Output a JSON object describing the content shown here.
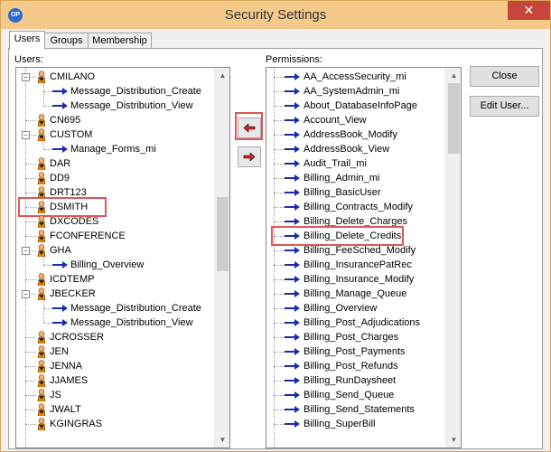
{
  "window": {
    "title": "Security Settings",
    "app_icon": "OP",
    "close_symbol": "✕",
    "close_icon": "close-icon"
  },
  "tabs": [
    {
      "label": "Users",
      "active": true
    },
    {
      "label": "Groups",
      "active": false
    },
    {
      "label": "Membership",
      "active": false
    }
  ],
  "users": {
    "caption": "Users:",
    "items": [
      {
        "label": "CMILANO",
        "type": "user",
        "expander": "−"
      },
      {
        "label": "Message_Distribution_Create",
        "type": "perm"
      },
      {
        "label": "Message_Distribution_View",
        "type": "perm"
      },
      {
        "label": "CN695",
        "type": "user"
      },
      {
        "label": "CUSTOM",
        "type": "user",
        "expander": "−"
      },
      {
        "label": "Manage_Forms_mi",
        "type": "perm"
      },
      {
        "label": "DAR",
        "type": "user"
      },
      {
        "label": "DD9",
        "type": "user"
      },
      {
        "label": "DRT123",
        "type": "user"
      },
      {
        "label": "DSMITH",
        "type": "user",
        "highlighted": true
      },
      {
        "label": "DXCODES",
        "type": "user"
      },
      {
        "label": "FCONFERENCE",
        "type": "user"
      },
      {
        "label": "GHA",
        "type": "user",
        "expander": "−"
      },
      {
        "label": "Billing_Overview",
        "type": "perm"
      },
      {
        "label": "ICDTEMP",
        "type": "user"
      },
      {
        "label": "JBECKER",
        "type": "user",
        "expander": "−"
      },
      {
        "label": "Message_Distribution_Create",
        "type": "perm"
      },
      {
        "label": "Message_Distribution_View",
        "type": "perm"
      },
      {
        "label": "JCROSSER",
        "type": "user"
      },
      {
        "label": "JEN",
        "type": "user"
      },
      {
        "label": "JENNA",
        "type": "user"
      },
      {
        "label": "JJAMES",
        "type": "user"
      },
      {
        "label": "JS",
        "type": "user"
      },
      {
        "label": "JWALT",
        "type": "user"
      },
      {
        "label": "KGINGRAS",
        "type": "user"
      }
    ]
  },
  "permissions": {
    "caption": "Permissions:",
    "items": [
      {
        "label": "AA_AccessSecurity_mi"
      },
      {
        "label": "AA_SystemAdmin_mi"
      },
      {
        "label": "About_DatabaseInfoPage"
      },
      {
        "label": "Account_View"
      },
      {
        "label": "AddressBook_Modify"
      },
      {
        "label": "AddressBook_View"
      },
      {
        "label": "Audit_Trail_mi"
      },
      {
        "label": "Billing_Admin_mi"
      },
      {
        "label": "Billing_BasicUser"
      },
      {
        "label": "Billing_Contracts_Modify"
      },
      {
        "label": "Billing_Delete_Charges"
      },
      {
        "label": "Billing_Delete_Credits",
        "highlighted": true
      },
      {
        "label": "Billing_FeeSched_Modify"
      },
      {
        "label": "Billing_InsurancePatRec"
      },
      {
        "label": "Billing_Insurance_Modify"
      },
      {
        "label": "Billing_Manage_Queue"
      },
      {
        "label": "Billing_Overview"
      },
      {
        "label": "Billing_Post_Adjudications"
      },
      {
        "label": "Billing_Post_Charges"
      },
      {
        "label": "Billing_Post_Payments"
      },
      {
        "label": "Billing_Post_Refunds"
      },
      {
        "label": "Billing_RunDaysheet"
      },
      {
        "label": "Billing_Send_Queue"
      },
      {
        "label": "Billing_Send_Statements"
      },
      {
        "label": "Billing_SuperBill"
      }
    ]
  },
  "buttons": {
    "close": "Close",
    "edit_user": "Edit User..."
  },
  "colors": {
    "titlebar": "#f4c98a",
    "close": "#c7463c",
    "highlight": "#e05555",
    "arrow": "#1a2bb0",
    "move_arrow": "#e02020"
  }
}
